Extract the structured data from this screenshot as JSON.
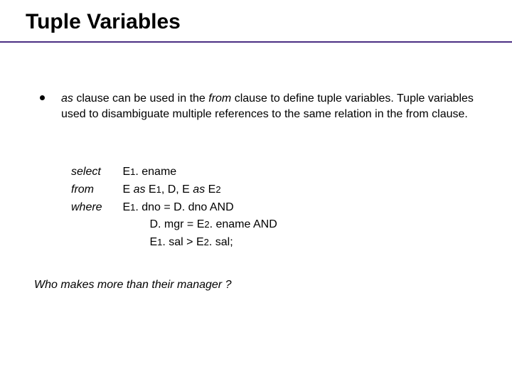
{
  "title": "Tuple Variables",
  "bullet": {
    "seg1_it": "as ",
    "seg2": "clause can be used in the ",
    "seg3_it": "from ",
    "seg4": "clause to define tuple variables. Tuple variables used to disambiguate multiple references to the same relation in the from clause."
  },
  "sql": {
    "select_kw": "select",
    "from_kw": "from",
    "where_kw": "where",
    "as_kw": "as",
    "line1_rest": "E1. ename",
    "line2_a": "E ",
    "line2_b": " E1,  D,  E ",
    "line2_c": " E2",
    "line3": "E1. dno = D. dno  AND",
    "line4": "D. mgr  = E2. ename   AND",
    "line5": "E1. sal  > E2. sal;",
    "sub1": "1",
    "sub2": "2"
  },
  "question": "Who makes more than their manager ?"
}
